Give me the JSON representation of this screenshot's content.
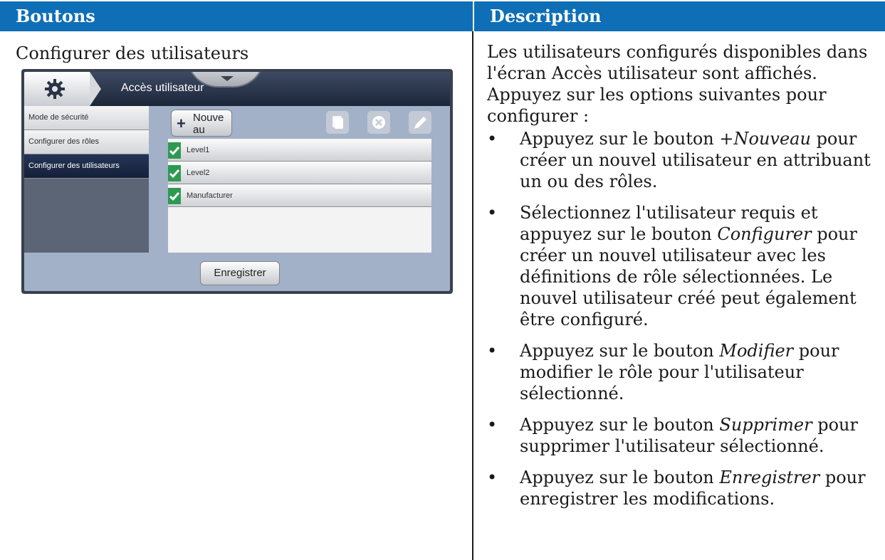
{
  "table": {
    "header_left": "Boutons",
    "header_right": "Description",
    "left_title": "Configurer des utilisateurs"
  },
  "screen": {
    "title": "Accès utilisateur",
    "sidebar_items": [
      "Mode de sécurité",
      "Configurer des rôles",
      "Configurer des utilisateurs"
    ],
    "new_button_label": "Nouve au",
    "users": [
      "Level1",
      "Level2",
      "Manufacturer"
    ],
    "save_button_label": "Enregistrer"
  },
  "description": {
    "intro": "Les utilisateurs configurés disponibles dans l'écran Accès utilisateur sont affichés. Appuyez sur les options suivantes pour configurer :",
    "bullets": [
      {
        "pre": "Appuyez sur le bouton +",
        "em": "Nouveau",
        "post": " pour créer un nouvel utilisateur en attribuant un ou des rôles."
      },
      {
        "pre": "Sélectionnez l'utilisateur requis et appuyez sur le bouton ",
        "em": "Configurer",
        "post": " pour créer un nouvel utilisateur avec les définitions de rôle sélectionnées. Le nouvel utilisateur créé peut également être configuré."
      },
      {
        "pre": "Appuyez sur le bouton ",
        "em": "Modifier",
        "post": " pour modifier le rôle pour l'utilisateur sélectionné."
      },
      {
        "pre": "Appuyez sur le bouton ",
        "em": "Supprimer",
        "post": " pour supprimer l'utilisateur sélectionné."
      },
      {
        "pre": "Appuyez sur le bouton ",
        "em": "Enregistrer",
        "post": " pour enregistrer les modifications."
      }
    ],
    "bullet_symbol": "•"
  }
}
